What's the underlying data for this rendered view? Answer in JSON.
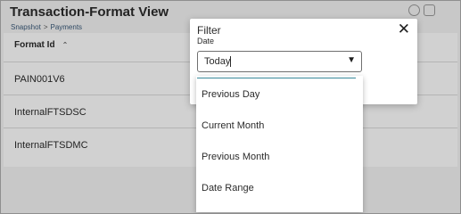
{
  "page": {
    "title": "Transaction-Format View",
    "breadcrumb": [
      "Snapshot",
      "Payments"
    ],
    "breadcrumb_separator": ">"
  },
  "top_icons": [
    "settings-icon",
    "calendar-icon"
  ],
  "table": {
    "column_header": "Format Id",
    "sort_icon": "⌃",
    "rows": [
      "PAIN001V6",
      "InternalFTSDSC",
      "InternalFTSDMC"
    ]
  },
  "filter": {
    "title": "Filter",
    "close_icon": "✕",
    "field_label": "Date",
    "selected": "Today",
    "arrow_icon": "▼",
    "options": [
      "Previous Day",
      "Current Month",
      "Previous Month",
      "Date Range"
    ]
  },
  "colors": {
    "accent": "#3a8a9a",
    "overlay": "rgba(0,0,0,0.18)"
  }
}
